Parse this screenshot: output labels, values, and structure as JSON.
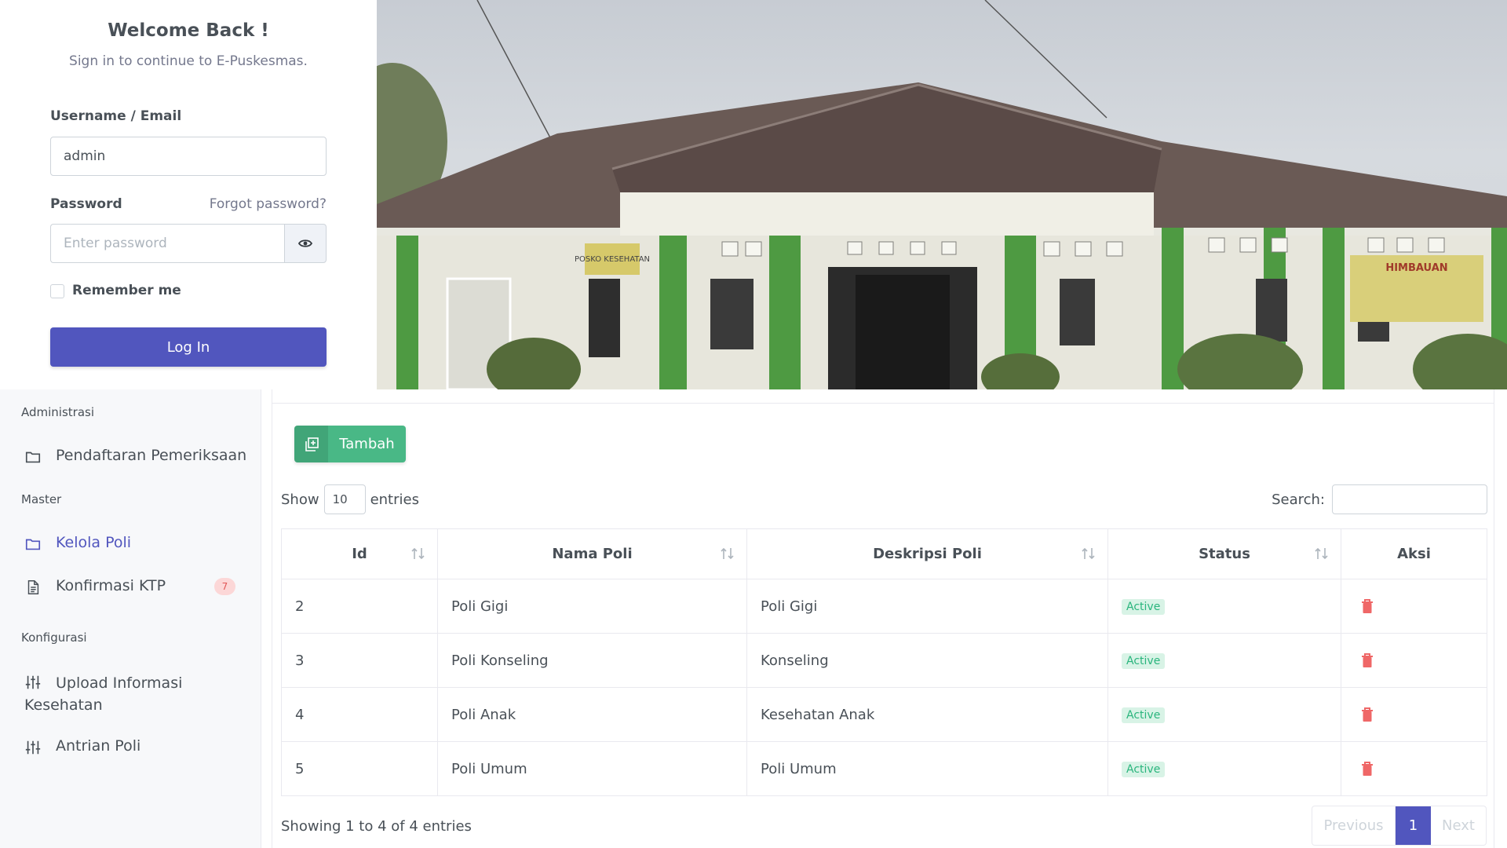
{
  "login": {
    "title": "Welcome Back !",
    "subtitle": "Sign in to continue to E-Puskesmas.",
    "username_label": "Username / Email",
    "username_value": "admin",
    "password_label": "Password",
    "forgot_label": "Forgot password?",
    "password_placeholder": "Enter password",
    "remember_label": "Remember me",
    "login_button": "Log In"
  },
  "photo": {
    "sign_posko": "POSKO KESEHATAN",
    "sign_himbauan": "HIMBAUAN"
  },
  "sidebar": {
    "section_admin": "Administrasi",
    "item_pendaftaran": "Pendaftaran Pemeriksaan",
    "section_master": "Master",
    "item_kelola_poli": "Kelola Poli",
    "item_konfirmasi_ktp": "Konfirmasi KTP",
    "konfirmasi_badge": "7",
    "section_konfigurasi": "Konfigurasi",
    "item_upload_line1": "Upload Informasi",
    "item_upload_line2": "Kesehatan",
    "item_antrian": "Antrian Poli"
  },
  "main": {
    "add_button": "Tambah",
    "show_label": "Show",
    "show_value": "10",
    "entries_label": "entries",
    "search_label": "Search:",
    "columns": [
      "Id",
      "Nama Poli",
      "Deskripsi Poli",
      "Status",
      "Aksi"
    ],
    "rows": [
      {
        "id": "2",
        "nama": "Poli Gigi",
        "deskripsi": "Poli Gigi",
        "status": "Active"
      },
      {
        "id": "3",
        "nama": "Poli Konseling",
        "deskripsi": "Konseling",
        "status": "Active"
      },
      {
        "id": "4",
        "nama": "Poli Anak",
        "deskripsi": "Kesehatan Anak",
        "status": "Active"
      },
      {
        "id": "5",
        "nama": "Poli Umum",
        "deskripsi": "Poli Umum",
        "status": "Active"
      }
    ],
    "info": "Showing 1 to 4 of 4 entries",
    "pager_prev": "Previous",
    "pager_current": "1",
    "pager_next": "Next"
  },
  "colors": {
    "primary": "#5156be",
    "success": "#49b886",
    "danger": "#ef6767"
  }
}
